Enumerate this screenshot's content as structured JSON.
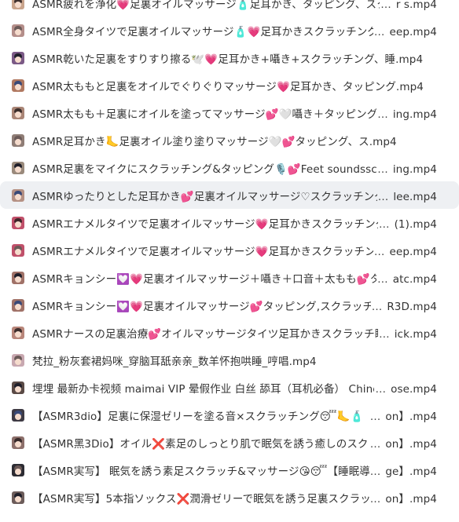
{
  "files": [
    {
      "thumb": "#c9a48c",
      "head": "ASMR疲れを浄化💗足裏オイルマッサージ🧴足耳かき、タッピング、スクラ",
      "tail": "r s.mp4",
      "full": false
    },
    {
      "thumb": "#b48e8a",
      "head": "ASMR全身タイツで足裏オイルマッサージ🧴💗足耳かきスクラッチングタ",
      "tail": "eep.mp4",
      "full": false
    },
    {
      "thumb": "#7b5a86",
      "head": "ASMR乾いた足裏をすりすり擦る🕊️💗足耳かき+囁き+スクラッチング、睡.mp4",
      "tail": "",
      "full": true
    },
    {
      "thumb": "#b07860",
      "head": "ASMR太ももと足裏をオイルでぐりぐりマッサージ💗足耳かき、タッピング.mp4",
      "tail": "",
      "full": true
    },
    {
      "thumb": "#a98576",
      "head": "ASMR太もも＋足裏にオイルを塗ってマッサージ💕🤍囁き＋タッピング＋",
      "tail": "ing.mp4",
      "full": false
    },
    {
      "thumb": "#8f7d76",
      "head": "ASMR足耳かき🦶足裏オイル塗り塗りマッサージ🤍💕タッピング、ス.mp4",
      "tail": "",
      "full": true
    },
    {
      "thumb": "#9a8a7c",
      "head": "ASMR足裏をマイクにスクラッチング&タッピング🎙️💕Feet soundsscratc",
      "tail": "ing.mp4",
      "full": false
    },
    {
      "thumb": "#b59184",
      "head": "ASMRゆったりとした足耳かき💕足裏オイルマッサージ♡スクラッチング、",
      "tail": "lee.mp4",
      "full": false,
      "selected": true
    },
    {
      "thumb": "#c0506a",
      "head": "ASMRエナメルタイツで足裏オイルマッサージ💗足耳かきスクラッチングタ",
      "tail": "(1).mp4",
      "full": false
    },
    {
      "thumb": "#c0506a",
      "head": "ASMRエナメルタイツで足裏オイルマッサージ💗足耳かきスクラッチングタ",
      "tail": "eep.mp4",
      "full": false
    },
    {
      "thumb": "#a07268",
      "head": "ASMRキョンシー💟💗足裏オイルマッサージ＋囁き＋口音＋太もも💕タッ",
      "tail": "atc.mp4",
      "full": false
    },
    {
      "thumb": "#a07268",
      "head": "ASMRキョンシー💟💗足裏オイルマッサージ💕タッピング,スクラッチン",
      "tail": "R3D.mp4",
      "full": false
    },
    {
      "thumb": "#b8867a",
      "head": "ASMRナースの足裏治療💕オイルマッサージタイツ足耳かきスクラッチ睡眠",
      "tail": "ick.mp4",
      "full": false
    },
    {
      "thumb": "#c8a8b0",
      "head": "梵拉_粉灰套裙妈咪_穿脑耳舐亲亲_数羊怀抱哄睡_哼唱.mp4",
      "tail": "",
      "full": true
    },
    {
      "thumb": "#5a4a46",
      "head": "埋埋 最新办卡视频 maimai VIP 晕假作业 白丝 舔耳（耳机必备） Chinese A",
      "tail": "ose.mp4",
      "full": false
    },
    {
      "thumb": "#3e3a44",
      "head": "【ASMR3dio】足裏に保湿ゼリーを塗る音×スクラッチング😴🦶🧴【睡",
      "tail": "on】.mp4",
      "full": false
    },
    {
      "thumb": "#8c6f6a",
      "head": "【ASMR黑3Dio】オイル❌素足のしっとり肌で眠気を誘う癒しのスクラッ",
      "tail": "on】.mp4",
      "full": false
    },
    {
      "thumb": "#2d2c33",
      "head": "【ASMR実写】 眠気を誘う素足スクラッチ&マッサージ😘😴【睡眠導入ti",
      "tail": "ge】.mp4",
      "full": false
    },
    {
      "thumb": "#6c5c5a",
      "head": "【ASMR実写】5本指ソックス❌潤滑ゼリーで眠気を誘う足裏スクラッチ",
      "tail": "on】.mp4",
      "full": false
    }
  ]
}
